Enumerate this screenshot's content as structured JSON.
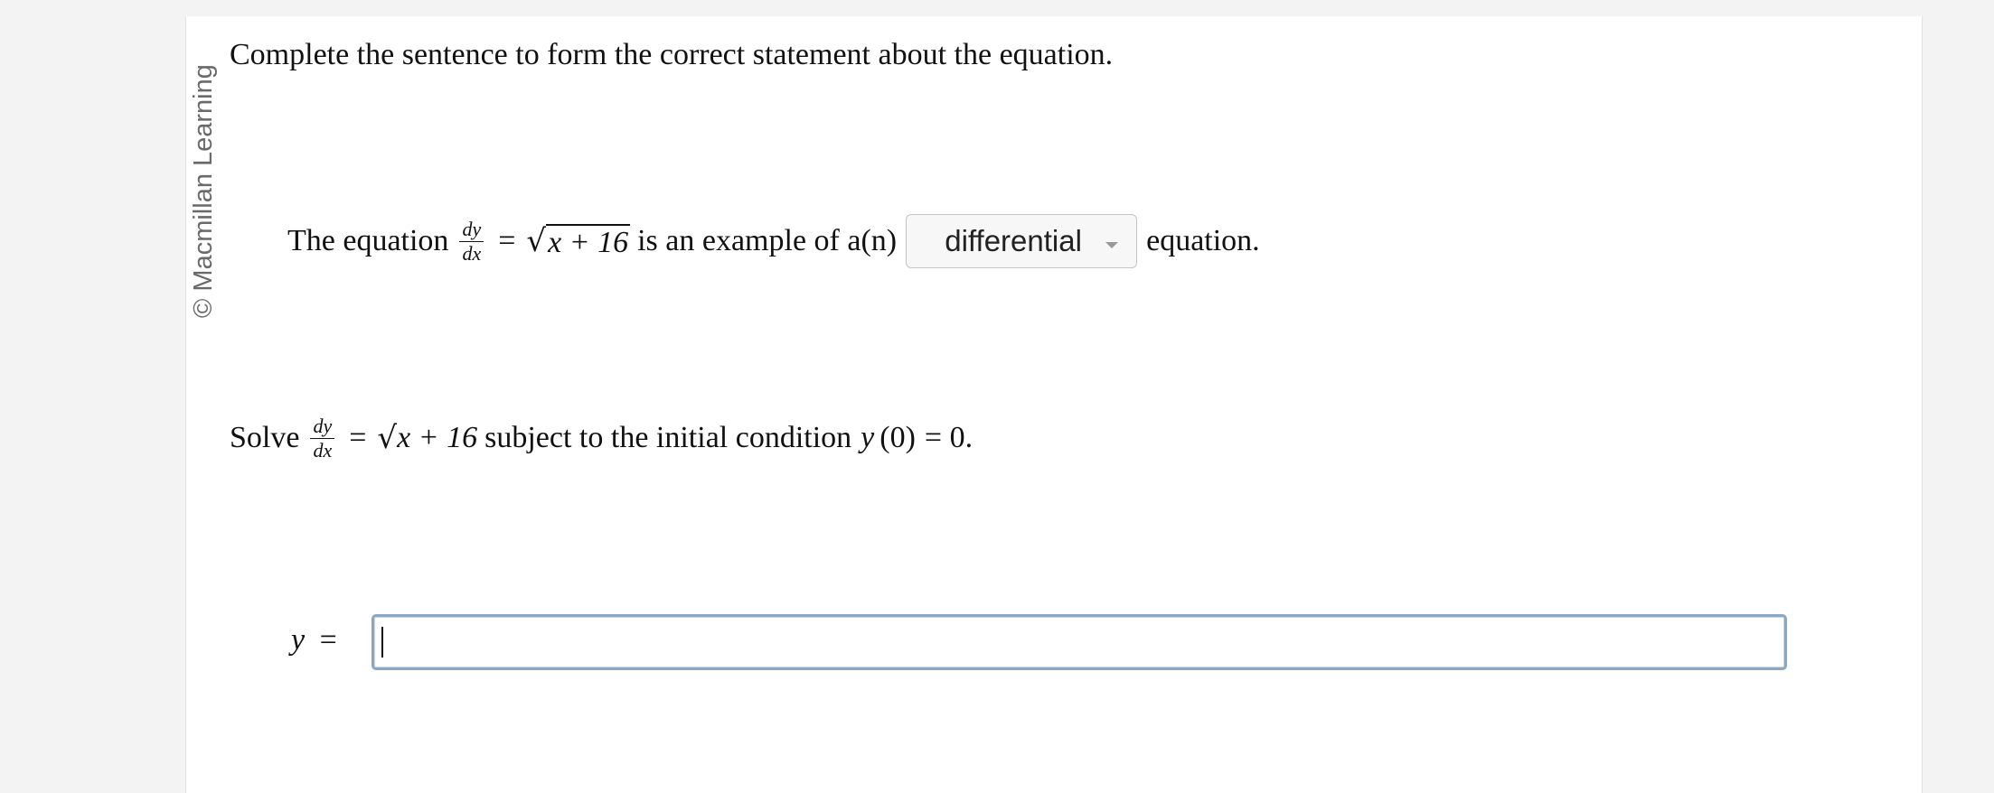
{
  "watermark": "© Macmillan Learning",
  "question": {
    "prompt": "Complete the sentence to form the correct statement about the equation.",
    "sentence": {
      "before": "The equation",
      "frac_num": "dy",
      "frac_den": "dx",
      "equals": "=",
      "radicand": "x + 16",
      "middle": "is an example of a(n)",
      "dropdown_value": "differential",
      "after": "equation."
    },
    "solve": {
      "before": "Solve",
      "frac_num": "dy",
      "frac_den": "dx",
      "equals": "=",
      "radicand": "x + 16",
      "condition_text": "subject to the initial condition",
      "condition_var": "y",
      "condition_arg": "(0)",
      "condition_eq": "= 0."
    },
    "answer": {
      "var": "y",
      "equals": "=",
      "value": ""
    }
  },
  "colors": {
    "page_bg": "#f3f3f3",
    "input_border": "#8da7c3",
    "dropdown_bg": "#f7f7f7"
  },
  "icons": {
    "dropdown_caret": "chevron-down-icon"
  }
}
